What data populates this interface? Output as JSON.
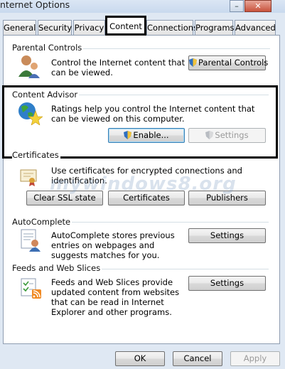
{
  "window": {
    "title": "Internet Options",
    "title_visible": "nternet Options"
  },
  "tabs": [
    {
      "label": "General"
    },
    {
      "label": "Security"
    },
    {
      "label": "Privacy"
    },
    {
      "label": "Content"
    },
    {
      "label": "Connections"
    },
    {
      "label": "Programs"
    },
    {
      "label": "Advanced"
    }
  ],
  "parental": {
    "label": "Parental Controls",
    "description": "Control the Internet content that can be viewed.",
    "button": "Parental Controls"
  },
  "advisor": {
    "label": "Content Advisor",
    "description": "Ratings help you control the Internet content that can be viewed on this computer.",
    "enable_button": "Enable...",
    "settings_button": "Settings"
  },
  "certificates": {
    "label": "Certificates",
    "description": "Use certificates for encrypted connections and identification.",
    "clear_ssl": "Clear SSL state",
    "certificates_button": "Certificates",
    "publishers": "Publishers"
  },
  "autocomplete": {
    "label": "AutoComplete",
    "description": "AutoComplete stores previous entries on webpages and suggests matches for you.",
    "button": "Settings"
  },
  "feeds": {
    "label": "Feeds and Web Slices",
    "description": "Feeds and Web Slices provide updated content from websites that can be read in Internet Explorer and other programs.",
    "button": "Settings"
  },
  "footer": {
    "ok": "OK",
    "cancel": "Cancel",
    "apply": "Apply"
  },
  "watermark": "mywindows8.org",
  "colors": {
    "accent": "#3c7fb1",
    "highlight": "#000000",
    "window_bg": "#dfe8f3"
  }
}
